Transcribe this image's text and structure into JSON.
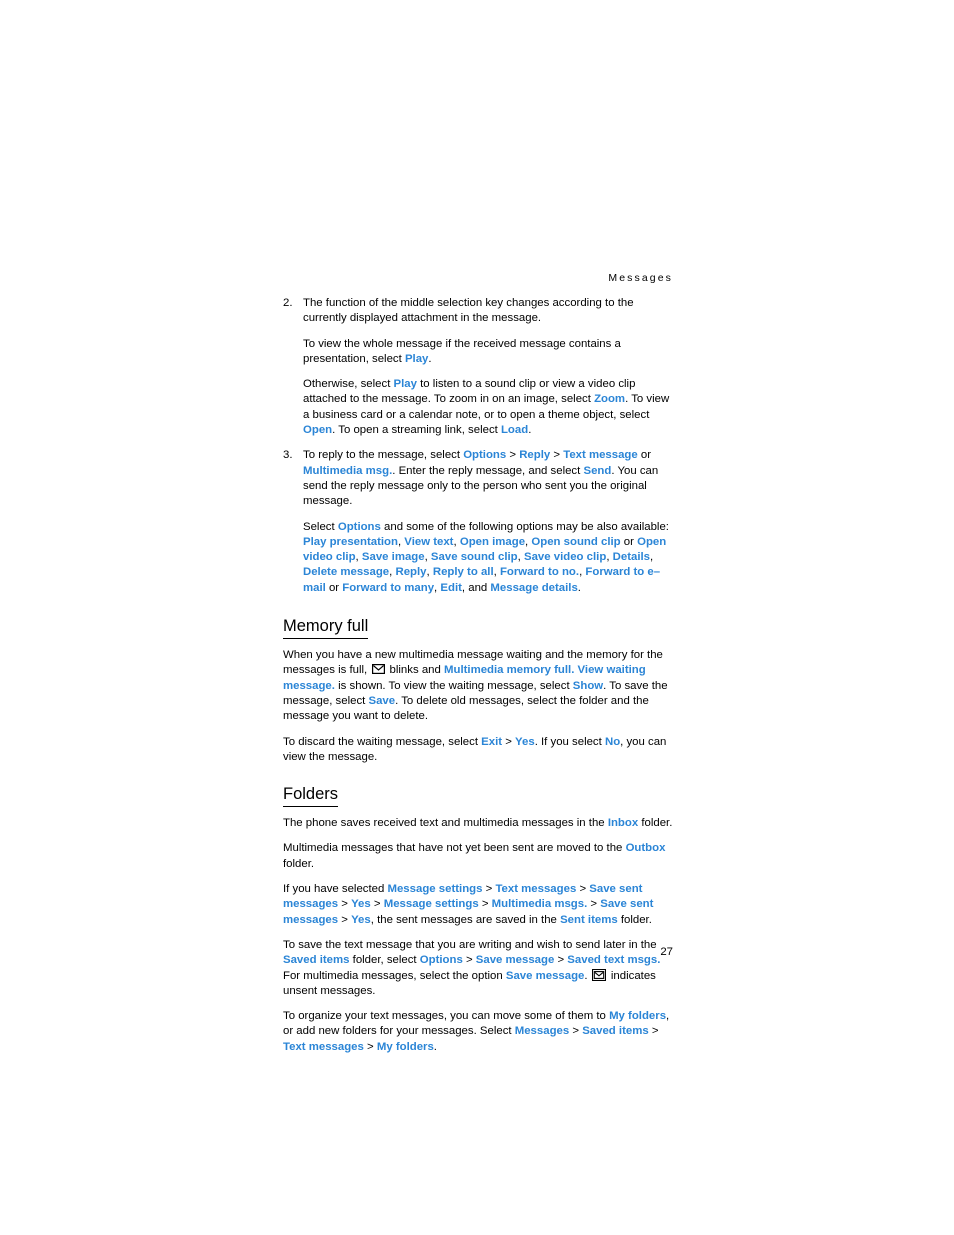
{
  "page": {
    "running_head": "Messages",
    "folio": "27",
    "link_color": "#2b85d6",
    "text_color": "#000000",
    "background": "#ffffff"
  },
  "list": [
    {
      "number": "2.",
      "paragraphs": [
        [
          {
            "t": "The function of the middle selection key changes according to the currently displayed attachment in the message."
          }
        ],
        [
          {
            "t": "To view the whole message if the received message contains a presentation, select "
          },
          {
            "t": "Play",
            "ui": true
          },
          {
            "t": "."
          }
        ],
        [
          {
            "t": "Otherwise, select "
          },
          {
            "t": "Play",
            "ui": true
          },
          {
            "t": " to listen to a sound clip or view a video clip attached to the message. To zoom in on an image, select "
          },
          {
            "t": "Zoom",
            "ui": true
          },
          {
            "t": ". To view a business card or a calendar note, or to open a theme object, select "
          },
          {
            "t": "Open",
            "ui": true
          },
          {
            "t": ". To open a streaming link, select "
          },
          {
            "t": "Load",
            "ui": true
          },
          {
            "t": "."
          }
        ]
      ]
    },
    {
      "number": "3.",
      "paragraphs": [
        [
          {
            "t": "To reply to the message, select "
          },
          {
            "t": "Options",
            "ui": true
          },
          {
            "t": " > ",
            "sep": true
          },
          {
            "t": "Reply",
            "ui": true
          },
          {
            "t": " > ",
            "sep": true
          },
          {
            "t": "Text message",
            "ui": true
          },
          {
            "t": " or "
          },
          {
            "t": "Multimedia msg.",
            "ui": true
          },
          {
            "t": ". Enter the reply message, and select "
          },
          {
            "t": "Send",
            "ui": true
          },
          {
            "t": ". You can send the reply message only to the person who sent you the original message."
          }
        ],
        [
          {
            "t": "Select "
          },
          {
            "t": "Options",
            "ui": true
          },
          {
            "t": " and some of the following options may be also available: "
          },
          {
            "t": "Play presentation",
            "ui": true
          },
          {
            "t": ", "
          },
          {
            "t": "View text",
            "ui": true
          },
          {
            "t": ", "
          },
          {
            "t": "Open image",
            "ui": true
          },
          {
            "t": ", "
          },
          {
            "t": "Open sound clip",
            "ui": true
          },
          {
            "t": " or "
          },
          {
            "t": "Open video clip",
            "ui": true
          },
          {
            "t": ", "
          },
          {
            "t": "Save image",
            "ui": true
          },
          {
            "t": ", "
          },
          {
            "t": "Save sound clip",
            "ui": true
          },
          {
            "t": ", "
          },
          {
            "t": "Save video clip",
            "ui": true
          },
          {
            "t": ", "
          },
          {
            "t": "Details",
            "ui": true
          },
          {
            "t": ", "
          },
          {
            "t": "Delete message",
            "ui": true
          },
          {
            "t": ", "
          },
          {
            "t": "Reply",
            "ui": true
          },
          {
            "t": ", "
          },
          {
            "t": "Reply to all",
            "ui": true
          },
          {
            "t": ", "
          },
          {
            "t": "Forward to no.",
            "ui": true
          },
          {
            "t": ", "
          },
          {
            "t": "Forward to e–mail",
            "ui": true
          },
          {
            "t": " or "
          },
          {
            "t": "Forward to many",
            "ui": true
          },
          {
            "t": ", "
          },
          {
            "t": "Edit",
            "ui": true
          },
          {
            "t": ", and "
          },
          {
            "t": "Message details",
            "ui": true
          },
          {
            "t": "."
          }
        ]
      ]
    }
  ],
  "sections": [
    {
      "heading": "Memory full",
      "paragraphs": [
        [
          {
            "t": "When you have a new multimedia message waiting and the memory for the messages is full, "
          },
          {
            "icon": "envelope-icon"
          },
          {
            "t": " blinks and "
          },
          {
            "t": "Multimedia memory full. View waiting message.",
            "ui": true
          },
          {
            "t": " is shown. To view the waiting message, select "
          },
          {
            "t": "Show",
            "ui": true
          },
          {
            "t": ". To save the message, select "
          },
          {
            "t": "Save",
            "ui": true
          },
          {
            "t": ". To delete old messages, select the folder and the message you want to delete."
          }
        ],
        [
          {
            "t": "To discard the waiting message, select "
          },
          {
            "t": "Exit",
            "ui": true
          },
          {
            "t": " > ",
            "sep": true
          },
          {
            "t": "Yes",
            "ui": true
          },
          {
            "t": ". If you select "
          },
          {
            "t": "No",
            "ui": true
          },
          {
            "t": ", you can view the message."
          }
        ]
      ]
    },
    {
      "heading": "Folders",
      "paragraphs": [
        [
          {
            "t": "The phone saves received text and multimedia messages in the "
          },
          {
            "t": "Inbox",
            "ui": true
          },
          {
            "t": " folder."
          }
        ],
        [
          {
            "t": "Multimedia messages that have not yet been sent are moved to the "
          },
          {
            "t": "Outbox",
            "ui": true
          },
          {
            "t": " folder."
          }
        ],
        [
          {
            "t": "If you have selected "
          },
          {
            "t": "Message settings",
            "ui": true
          },
          {
            "t": " > ",
            "sep": true
          },
          {
            "t": "Text messages",
            "ui": true
          },
          {
            "t": " > ",
            "sep": true
          },
          {
            "t": "Save sent messages",
            "ui": true
          },
          {
            "t": " > ",
            "sep": true
          },
          {
            "t": "Yes",
            "ui": true
          },
          {
            "t": " > ",
            "sep": true
          },
          {
            "t": "Message settings",
            "ui": true
          },
          {
            "t": " > ",
            "sep": true
          },
          {
            "t": "Multimedia msgs.",
            "ui": true
          },
          {
            "t": " > ",
            "sep": true
          },
          {
            "t": "Save sent messages",
            "ui": true
          },
          {
            "t": " > ",
            "sep": true
          },
          {
            "t": "Yes",
            "ui": true
          },
          {
            "t": ", the sent messages are saved in the "
          },
          {
            "t": "Sent items",
            "ui": true
          },
          {
            "t": " folder."
          }
        ],
        [
          {
            "t": "To save the text message that you are writing and wish to send later in the "
          },
          {
            "t": "Saved items",
            "ui": true
          },
          {
            "t": " folder, select "
          },
          {
            "t": "Options",
            "ui": true
          },
          {
            "t": " > ",
            "sep": true
          },
          {
            "t": "Save message",
            "ui": true
          },
          {
            "t": " > ",
            "sep": true
          },
          {
            "t": "Saved text msgs.",
            "ui": true
          },
          {
            "t": " For multimedia messages, select the option "
          },
          {
            "t": "Save message",
            "ui": true
          },
          {
            "t": ". "
          },
          {
            "icon": "envelope-boxed-icon"
          },
          {
            "t": " indicates unsent messages."
          }
        ],
        [
          {
            "t": "To organize your text messages, you can move some of them to "
          },
          {
            "t": "My folders",
            "ui": true
          },
          {
            "t": ", or add new folders for your messages. Select "
          },
          {
            "t": "Messages",
            "ui": true
          },
          {
            "t": " > ",
            "sep": true
          },
          {
            "t": "Saved items",
            "ui": true
          },
          {
            "t": " > ",
            "sep": true
          },
          {
            "t": "Text messages",
            "ui": true
          },
          {
            "t": " > ",
            "sep": true
          },
          {
            "t": "My folders",
            "ui": true
          },
          {
            "t": "."
          }
        ]
      ]
    }
  ]
}
